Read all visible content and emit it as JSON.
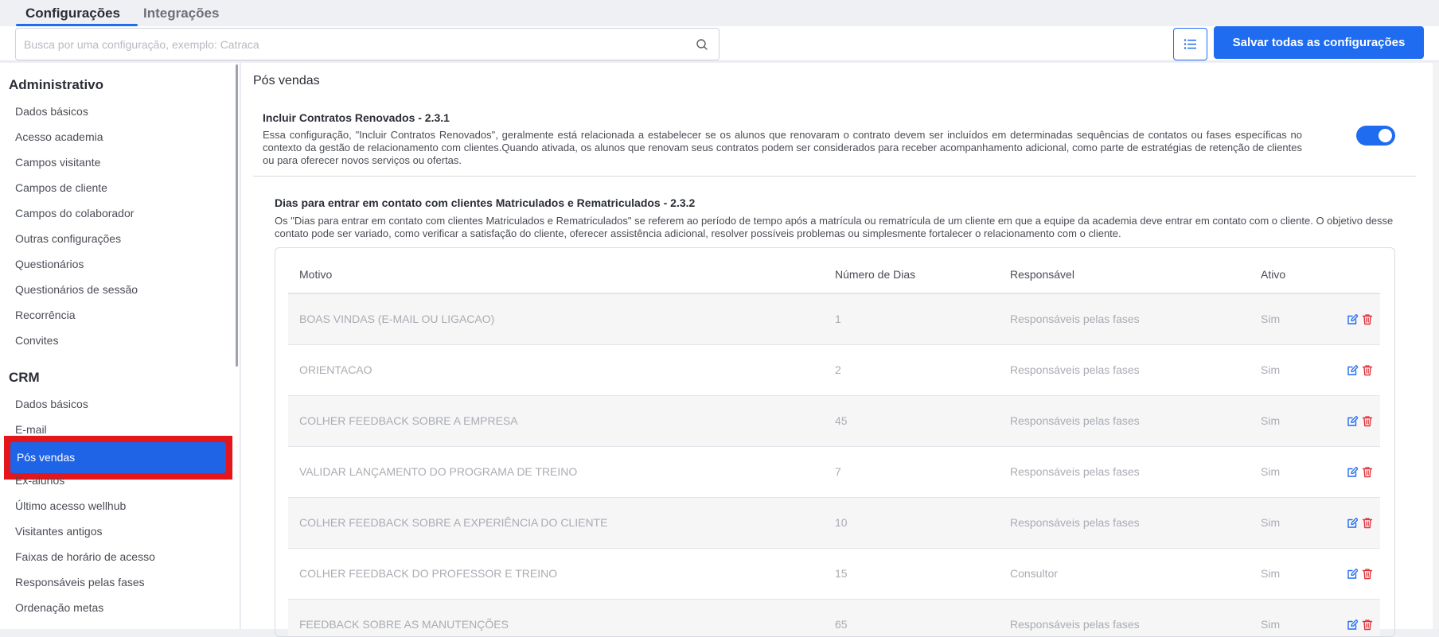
{
  "tabs": [
    {
      "label": "Configurações"
    },
    {
      "label": "Integrações"
    }
  ],
  "search": {
    "placeholder": "Busca por uma configuração, exemplo: Catraca"
  },
  "toolbar": {
    "save_label": "Salvar todas as configurações"
  },
  "sidebar": {
    "sections": [
      {
        "title": "Administrativo",
        "items": [
          "Dados básicos",
          "Acesso academia",
          "Campos visitante",
          "Campos de cliente",
          "Campos do colaborador",
          "Outras configurações",
          "Questionários",
          "Questionários de sessão",
          "Recorrência",
          "Convites"
        ]
      },
      {
        "title": "CRM",
        "items": [
          "Dados básicos",
          "E-mail",
          "Pós vendas",
          "Ex-alunos",
          "Último acesso wellhub",
          "Visitantes antigos",
          "Faixas de horário de acesso",
          "Responsáveis pelas fases",
          "Ordenação metas"
        ]
      }
    ],
    "active_item": "Pós vendas"
  },
  "main": {
    "title": "Pós vendas",
    "setting1": {
      "title": "Incluir Contratos Renovados - 2.3.1",
      "description": "Essa configuração, \"Incluir Contratos Renovados\", geralmente está relacionada a estabelecer se os alunos que renovaram o contrato devem ser incluídos em determinadas sequências de contatos ou fases específicas no contexto da gestão de relacionamento com clientes.Quando ativada, os alunos que renovam seus contratos podem ser considerados para receber acompanhamento adicional, como parte de estratégias de retenção de clientes ou para oferecer novos serviços ou ofertas.",
      "enabled": true
    },
    "setting2": {
      "title": "Dias para entrar em contato com clientes Matriculados e Rematriculados - 2.3.2",
      "description": "Os \"Dias para entrar em contato com clientes Matriculados e Rematriculados\" se referem ao período de tempo após a matrícula ou rematrícula de um cliente em que a equipe da academia deve entrar em contato com o cliente. O objetivo desse contato pode ser variado, como verificar a satisfação do cliente, oferecer assistência adicional, resolver possíveis problemas ou simplesmente fortalecer o relacionamento com o cliente."
    },
    "table": {
      "headers": [
        "Motivo",
        "Número de Dias",
        "Responsável",
        "Ativo"
      ],
      "rows": [
        {
          "motivo": "BOAS VINDAS (E-MAIL OU LIGACAO)",
          "dias": "1",
          "responsavel": "Responsáveis pelas fases",
          "ativo": "Sim"
        },
        {
          "motivo": "ORIENTACAO",
          "dias": "2",
          "responsavel": "Responsáveis pelas fases",
          "ativo": "Sim"
        },
        {
          "motivo": "COLHER FEEDBACK SOBRE A EMPRESA",
          "dias": "45",
          "responsavel": "Responsáveis pelas fases",
          "ativo": "Sim"
        },
        {
          "motivo": "VALIDAR LANÇAMENTO DO PROGRAMA DE TREINO",
          "dias": "7",
          "responsavel": "Responsáveis pelas fases",
          "ativo": "Sim"
        },
        {
          "motivo": "COLHER FEEDBACK SOBRE A EXPERIÊNCIA DO CLIENTE",
          "dias": "10",
          "responsavel": "Responsáveis pelas fases",
          "ativo": "Sim"
        },
        {
          "motivo": "COLHER FEEDBACK DO PROFESSOR E TREINO",
          "dias": "15",
          "responsavel": "Consultor",
          "ativo": "Sim"
        },
        {
          "motivo": "FEEDBACK SOBRE AS MANUTENÇÕES",
          "dias": "65",
          "responsavel": "Responsáveis pelas fases",
          "ativo": "Sim"
        }
      ],
      "row_actions": {
        "edit_icon": "edit-icon",
        "delete_icon": "trash-icon"
      }
    }
  },
  "colors": {
    "accent": "#1f6cf0",
    "highlight": "#e3161b",
    "delete": "#e0313a"
  }
}
